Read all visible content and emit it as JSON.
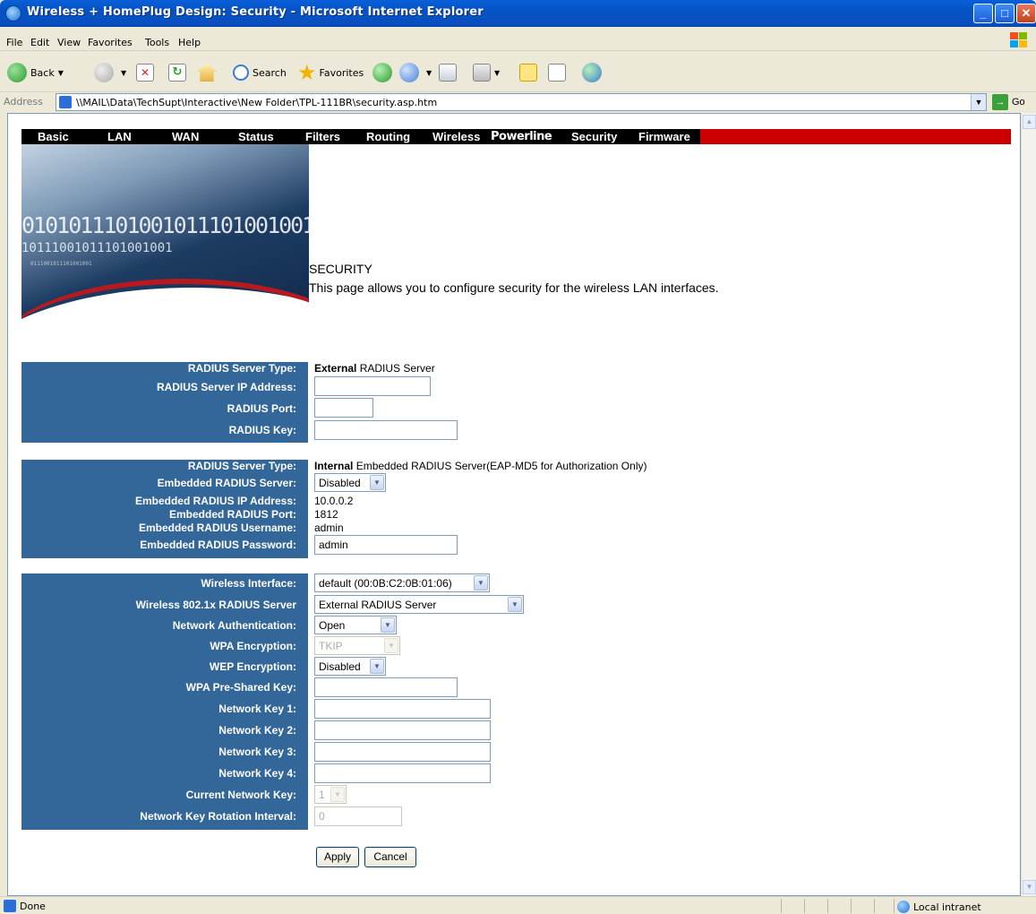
{
  "window": {
    "title": "Wireless + HomePlug Design: Security - Microsoft Internet Explorer"
  },
  "menu": [
    "File",
    "Edit",
    "View",
    "Favorites",
    "Tools",
    "Help"
  ],
  "toolbar": {
    "back": "Back",
    "search": "Search",
    "favorites": "Favorites"
  },
  "address": {
    "label": "Address",
    "url": "\\\\MAIL\\Data\\TechSupt\\Interactive\\New Folder\\TPL-111BR\\security.asp.htm",
    "go": "Go"
  },
  "nav": [
    "Basic",
    "LAN",
    "WAN",
    "Status",
    "Filters",
    "Routing",
    "Wireless",
    "Powerline",
    "Security",
    "Firmware"
  ],
  "banner": {
    "binary1": "0101011101001011101001001",
    "binary2": "10111001011101001001",
    "binary3": "0111001011101001001"
  },
  "page": {
    "title": "SECURITY",
    "description": "This page allows you to configure security for the wireless LAN interfaces."
  },
  "external": {
    "type_label": "RADIUS Server Type:",
    "type_bold": "External",
    "type_value": "RADIUS Server",
    "ip_label": "RADIUS Server IP Address:",
    "ip_value": "",
    "port_label": "RADIUS Port:",
    "port_value": "",
    "key_label": "RADIUS Key:",
    "key_value": ""
  },
  "internal": {
    "type_label": "RADIUS Server Type:",
    "type_bold": "Internal",
    "type_value": "Embedded RADIUS Server(EAP-MD5 for Authorization Only)",
    "server_label": "Embedded RADIUS Server:",
    "server_value": "Disabled",
    "ip_label": "Embedded RADIUS IP Address:",
    "ip_value": "10.0.0.2",
    "port_label": "Embedded RADIUS Port:",
    "port_value": "1812",
    "user_label": "Embedded RADIUS Username:",
    "user_value": "admin",
    "pass_label": "Embedded RADIUS Password:",
    "pass_value": "admin"
  },
  "wireless": {
    "iface_label": "Wireless Interface:",
    "iface_value": "default (00:0B:C2:0B:01:06)",
    "radius_label": "Wireless 802.1x RADIUS Server",
    "radius_value": "External RADIUS Server",
    "auth_label": "Network Authentication:",
    "auth_value": "Open",
    "wpa_label": "WPA Encryption:",
    "wpa_value": "TKIP",
    "wep_label": "WEP Encryption:",
    "wep_value": "Disabled",
    "psk_label": "WPA Pre-Shared Key:",
    "psk_value": "",
    "key1_label": "Network Key 1:",
    "key2_label": "Network Key 2:",
    "key3_label": "Network Key 3:",
    "key4_label": "Network Key 4:",
    "current_label": "Current Network Key:",
    "current_value": "1",
    "rotation_label": "Network Key Rotation Interval:",
    "rotation_value": "0"
  },
  "buttons": {
    "apply": "Apply",
    "cancel": "Cancel"
  },
  "status": {
    "text": "Done",
    "zone": "Local intranet"
  }
}
